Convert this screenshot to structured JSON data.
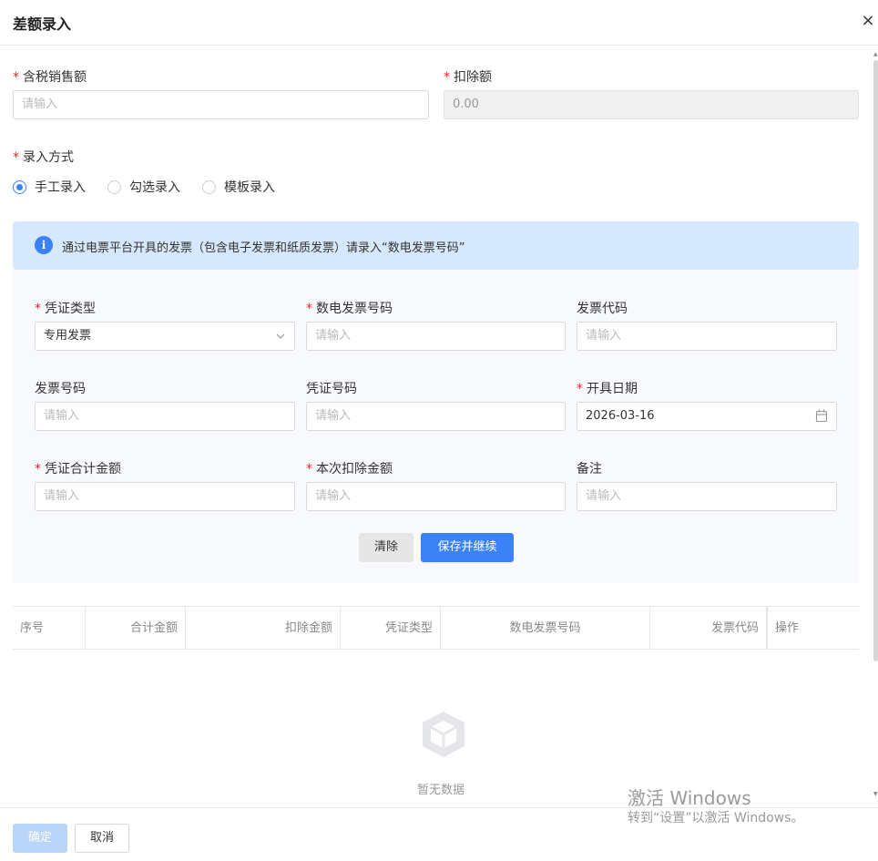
{
  "dialog": {
    "title": "差额录入",
    "close_icon": "×"
  },
  "fields": {
    "tax_sales": {
      "label": "含税销售额",
      "placeholder": "请输入"
    },
    "deduction": {
      "label": "扣除额",
      "value": "0.00"
    },
    "entry_method": {
      "label": "录入方式"
    }
  },
  "radios": [
    {
      "label": "手工录入",
      "checked": true
    },
    {
      "label": "勾选录入",
      "checked": false
    },
    {
      "label": "模板录入",
      "checked": false
    }
  ],
  "info": {
    "icon": "i",
    "text": "通过电票平台开具的发票（包含电子发票和纸质发票）请录入“数电发票号码”"
  },
  "form": {
    "voucher_type": {
      "label": "凭证类型",
      "value": "专用发票"
    },
    "digital_invoice_no": {
      "label": "数电发票号码",
      "placeholder": "请输入"
    },
    "invoice_code": {
      "label": "发票代码",
      "placeholder": "请输入"
    },
    "invoice_no": {
      "label": "发票号码",
      "placeholder": "请输入"
    },
    "voucher_no": {
      "label": "凭证号码",
      "placeholder": "请输入"
    },
    "issue_date": {
      "label": "开具日期",
      "value": "2026-03-16"
    },
    "voucher_total": {
      "label": "凭证合计金额",
      "placeholder": "请输入"
    },
    "current_deduction": {
      "label": "本次扣除金额",
      "placeholder": "请输入"
    },
    "remark": {
      "label": "备注",
      "placeholder": "请输入"
    },
    "clear_label": "清除",
    "save_continue_label": "保存并继续"
  },
  "table": {
    "columns": [
      "序号",
      "合计金额",
      "扣除金额",
      "凭证类型",
      "数电发票号码",
      "发票代码",
      "操作"
    ],
    "empty_text": "暂无数据"
  },
  "footer": {
    "confirm_label": "确定",
    "cancel_label": "取消"
  },
  "watermark": {
    "line1": "激活 Windows",
    "line2": "转到“设置”以激活 Windows。"
  },
  "colors": {
    "primary": "#3b82f6",
    "required": "#f5222d",
    "info_bg": "#d6e8fb"
  }
}
